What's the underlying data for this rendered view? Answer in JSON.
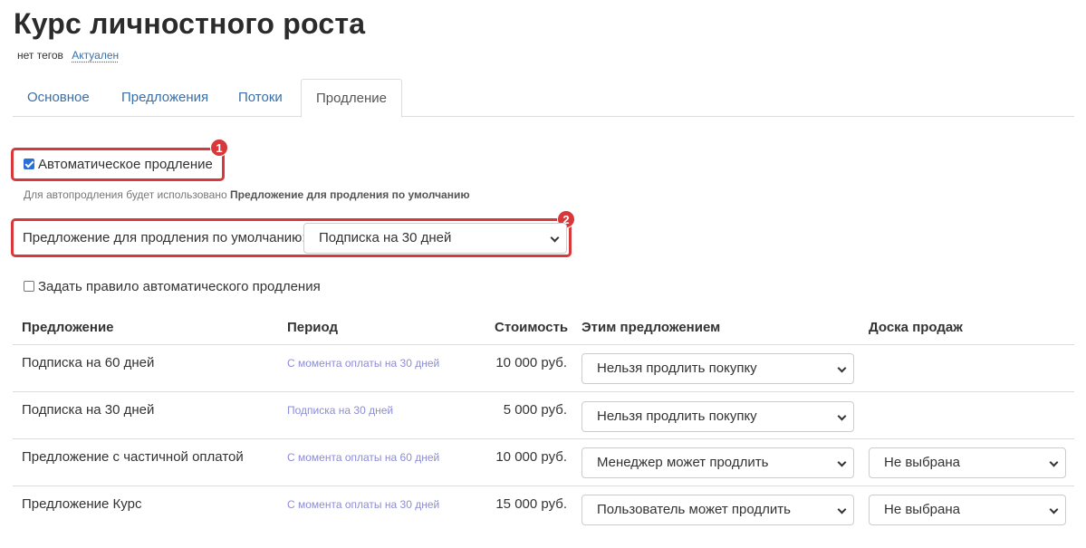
{
  "page": {
    "title": "Курс личностного роста",
    "tags_label": "нет тегов",
    "status_label": "Актуален"
  },
  "tabs": [
    {
      "label": "Основное"
    },
    {
      "label": "Предложения"
    },
    {
      "label": "Потоки"
    },
    {
      "label": "Продление",
      "active": true
    }
  ],
  "renewal": {
    "auto_renewal_label": "Автоматическое продление",
    "auto_renewal_checked": true,
    "hint_prefix": "Для автопродления будет использовано ",
    "hint_bold": "Предложение для продления по умолчанию",
    "default_offer_label": "Предложение для продления по умолчанию:",
    "default_offer_value": "Подписка на 30 дней",
    "rule_label": "Задать правило автоматического продления",
    "rule_checked": false
  },
  "annotations": [
    "1",
    "2"
  ],
  "table": {
    "headers": {
      "offer": "Предложение",
      "period": "Период",
      "price": "Стоимость",
      "action": "Этим предложением",
      "board": "Доска продаж"
    },
    "rows": [
      {
        "name": "Подписка на 60 дней",
        "period": "С момента оплаты на 30 дней",
        "price": "10 000 руб.",
        "action": "Нельзя продлить покупку",
        "board": ""
      },
      {
        "name": "Подписка на 30 дней",
        "period": "Подписка на 30 дней",
        "price": "5 000 руб.",
        "action": "Нельзя продлить покупку",
        "board": ""
      },
      {
        "name": "Предложение с частичной оплатой",
        "period": "С момента оплаты на 60 дней",
        "price": "10 000 руб.",
        "action": "Менеджер может продлить",
        "board": "Не выбрана"
      },
      {
        "name": "Предложение Курс",
        "period": "С момента оплаты на 30 дней",
        "price": "15 000 руб.",
        "action": "Пользователь может продлить",
        "board": "Не выбрана"
      }
    ]
  },
  "colors": {
    "link": "#3a6fa8",
    "highlight": "#d9383a",
    "period_text": "#8c8cd6"
  }
}
